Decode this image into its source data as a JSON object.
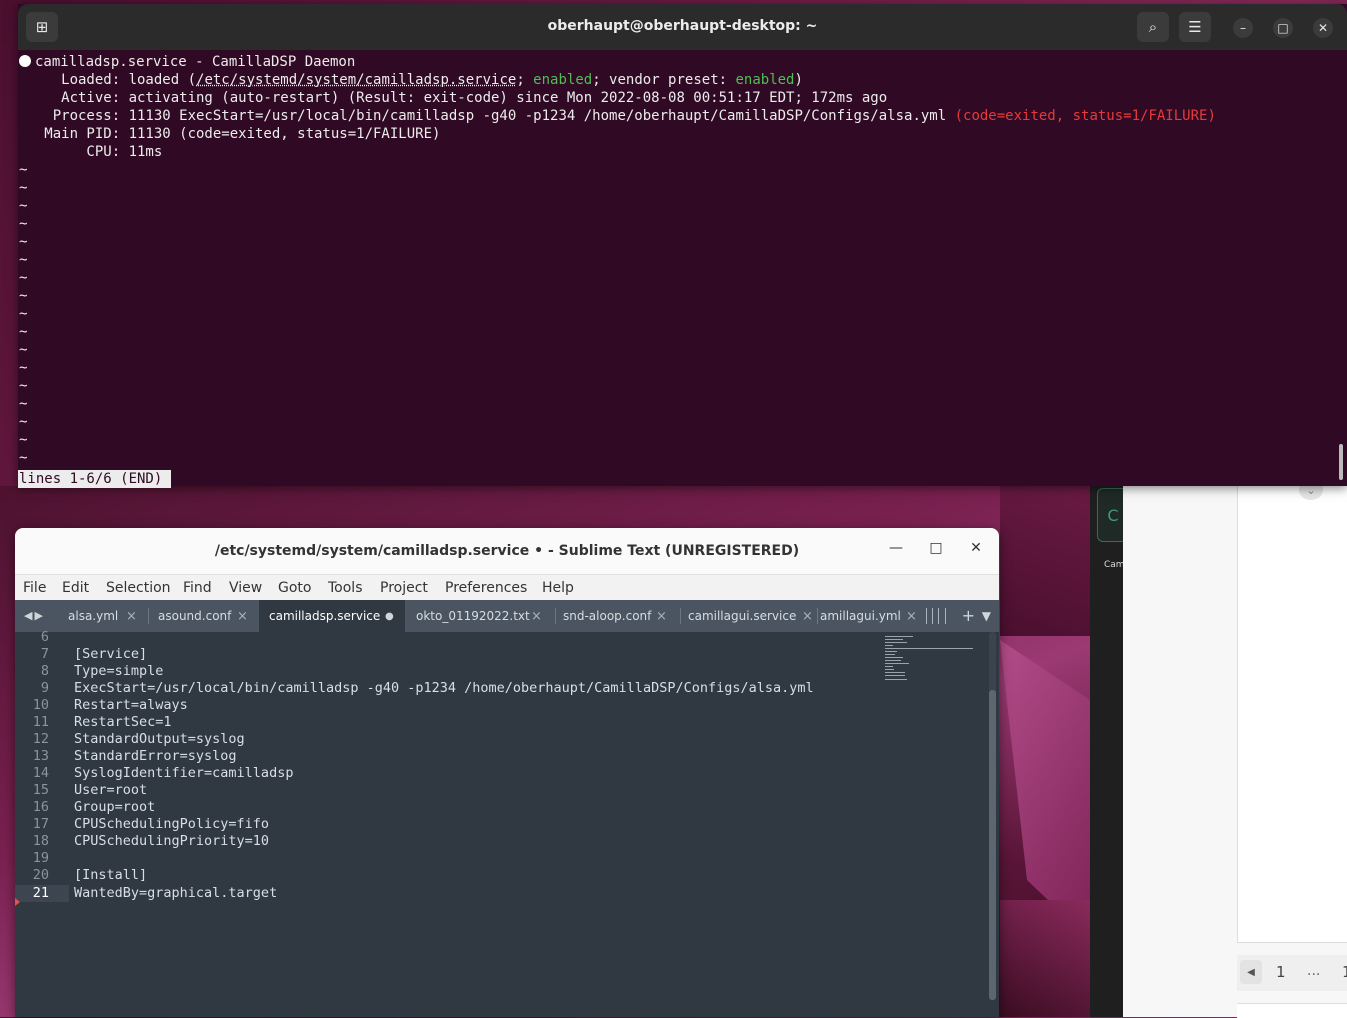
{
  "terminal": {
    "title": "oberhaupt@oberhaupt-desktop: ~",
    "lines": {
      "l1": "camilladsp.service - CamillaDSP Daemon",
      "l2a": "     Loaded: loaded (",
      "l2b": "/etc/systemd/system/camilladsp.service",
      "l2c": "; ",
      "l2d": "enabled",
      "l2e": "; vendor preset: ",
      "l2f": "enabled",
      "l2g": ")",
      "l3": "     Active: activating (auto-restart) (Result: exit-code) since Mon 2022-08-08 00:51:17 EDT; 172ms ago",
      "l4a": "    Process: 11130 ExecStart=/usr/local/bin/camilladsp -g40 -p1234 /home/oberhaupt/CamillaDSP/Configs/alsa.yml ",
      "l4b": "(code=exited, status=1/FAILURE)",
      "l5": "   Main PID: 11130 (code=exited, status=1/FAILURE)",
      "l6": "        CPU: 11ms"
    },
    "tilde": "~",
    "status": "lines 1-6/6 (END)"
  },
  "sublime": {
    "title": "/etc/systemd/system/camilladsp.service • - Sublime Text (UNREGISTERED)",
    "menu": [
      "File",
      "Edit",
      "Selection",
      "Find",
      "View",
      "Goto",
      "Tools",
      "Project",
      "Preferences",
      "Help"
    ],
    "tabs": [
      {
        "label": "alsa.yml",
        "close": "×"
      },
      {
        "label": "asound.conf",
        "close": "×"
      },
      {
        "label": "camilladsp.service",
        "close": "●"
      },
      {
        "label": "okto_01192022.txt",
        "close": "×"
      },
      {
        "label": "snd-aloop.conf",
        "close": "×"
      },
      {
        "label": "camillagui.service",
        "close": "×"
      },
      {
        "label": "amillagui.yml",
        "close": "×"
      }
    ],
    "lines": [
      {
        "n": "6",
        "t": ""
      },
      {
        "n": "7",
        "t": "[Service]"
      },
      {
        "n": "8",
        "t": "Type=simple"
      },
      {
        "n": "9",
        "t": "ExecStart=/usr/local/bin/camilladsp -g40 -p1234 /home/oberhaupt/CamillaDSP/Configs/alsa.yml"
      },
      {
        "n": "10",
        "t": "Restart=always"
      },
      {
        "n": "11",
        "t": "RestartSec=1"
      },
      {
        "n": "12",
        "t": "StandardOutput=syslog"
      },
      {
        "n": "13",
        "t": "StandardError=syslog"
      },
      {
        "n": "14",
        "t": "SyslogIdentifier=camilladsp"
      },
      {
        "n": "15",
        "t": "User=root"
      },
      {
        "n": "16",
        "t": "Group=root"
      },
      {
        "n": "17",
        "t": "CPUSchedulingPolicy=fifo"
      },
      {
        "n": "18",
        "t": "CPUSchedulingPriority=10"
      },
      {
        "n": "19",
        "t": ""
      },
      {
        "n": "20",
        "t": "[Install]"
      },
      {
        "n": "21",
        "t": "WantedBy=graphical.target"
      }
    ]
  },
  "right_window": {
    "button_letter": "C",
    "caption": "Cam",
    "pager": {
      "prev": "◀",
      "page": "1",
      "dots": "...",
      "last": "1"
    }
  },
  "icons": {
    "newtab": "⊞",
    "search": "⌕",
    "menu": "☰",
    "minimize": "–",
    "maximize": "□",
    "close": "✕",
    "chevron": "⌄",
    "sub_minimize": "—",
    "sub_maximize": "□",
    "sub_close": "✕",
    "tab_left": "◀",
    "tab_right": "▶",
    "plus": "+",
    "down": "▼"
  }
}
